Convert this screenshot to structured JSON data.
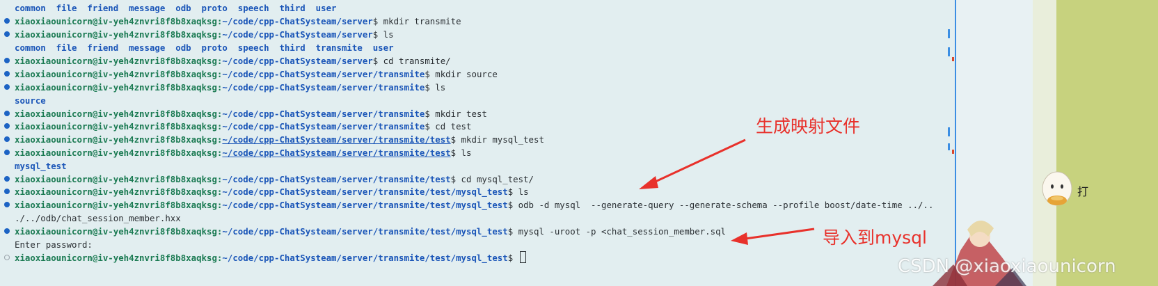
{
  "terminal": {
    "lines": [
      {
        "dot": "none",
        "prompt": "",
        "path": "",
        "cmd": "",
        "output": "common  file  friend  message  odb  proto  speech  third  user"
      },
      {
        "dot": "filled",
        "prompt": "xiaoxiaounicorn@iv-yeh4znvri8f8b8xaqksg:",
        "path": "~/code/cpp-ChatSysteam/server",
        "cmd": "$ mkdir transmite",
        "output": ""
      },
      {
        "dot": "filled",
        "prompt": "xiaoxiaounicorn@iv-yeh4znvri8f8b8xaqksg:",
        "path": "~/code/cpp-ChatSysteam/server",
        "cmd": "$ ls",
        "output": ""
      },
      {
        "dot": "none",
        "prompt": "",
        "path": "",
        "cmd": "",
        "output": "common  file  friend  message  odb  proto  speech  third  transmite  user"
      },
      {
        "dot": "filled",
        "prompt": "xiaoxiaounicorn@iv-yeh4znvri8f8b8xaqksg:",
        "path": "~/code/cpp-ChatSysteam/server",
        "cmd": "$ cd transmite/",
        "output": ""
      },
      {
        "dot": "filled",
        "prompt": "xiaoxiaounicorn@iv-yeh4znvri8f8b8xaqksg:",
        "path": "~/code/cpp-ChatSysteam/server/transmite",
        "cmd": "$ mkdir source",
        "output": ""
      },
      {
        "dot": "filled",
        "prompt": "xiaoxiaounicorn@iv-yeh4znvri8f8b8xaqksg:",
        "path": "~/code/cpp-ChatSysteam/server/transmite",
        "cmd": "$ ls",
        "output": ""
      },
      {
        "dot": "none",
        "prompt": "",
        "path": "",
        "cmd": "",
        "output": "source"
      },
      {
        "dot": "filled",
        "prompt": "xiaoxiaounicorn@iv-yeh4znvri8f8b8xaqksg:",
        "path": "~/code/cpp-ChatSysteam/server/transmite",
        "cmd": "$ mkdir test",
        "output": ""
      },
      {
        "dot": "filled",
        "prompt": "xiaoxiaounicorn@iv-yeh4znvri8f8b8xaqksg:",
        "path": "~/code/cpp-ChatSysteam/server/transmite",
        "cmd": "$ cd test",
        "output": ""
      },
      {
        "dot": "filled",
        "prompt": "xiaoxiaounicorn@iv-yeh4znvri8f8b8xaqksg:",
        "path": "~/code/cpp-ChatSysteam/server/transmite/test",
        "cmd": "$ mkdir mysql_test",
        "output": ""
      },
      {
        "dot": "filled",
        "prompt": "xiaoxiaounicorn@iv-yeh4znvri8f8b8xaqksg:",
        "path": "~/code/cpp-ChatSysteam/server/transmite/test",
        "cmd": "$ ls",
        "output": ""
      },
      {
        "dot": "none",
        "prompt": "",
        "path": "",
        "cmd": "",
        "output": "mysql_test"
      },
      {
        "dot": "filled",
        "prompt": "xiaoxiaounicorn@iv-yeh4znvri8f8b8xaqksg:",
        "path": "~/code/cpp-ChatSysteam/server/transmite/test",
        "cmd": "$ cd mysql_test/",
        "output": ""
      },
      {
        "dot": "filled",
        "prompt": "xiaoxiaounicorn@iv-yeh4znvri8f8b8xaqksg:",
        "path": "~/code/cpp-ChatSysteam/server/transmite/test/mysql_test",
        "cmd": "$ ls",
        "output": ""
      },
      {
        "dot": "filled",
        "prompt": "xiaoxiaounicorn@iv-yeh4znvri8f8b8xaqksg:",
        "path": "~/code/cpp-ChatSysteam/server/transmite/test/mysql_test",
        "cmd": "$ odb -d mysql  --generate-query --generate-schema --profile boost/date-time ../..",
        "output": ""
      },
      {
        "dot": "none",
        "prompt": "",
        "path": "",
        "cmd": "",
        "output": "./../odb/chat_session_member.hxx",
        "plain": true
      },
      {
        "dot": "filled",
        "prompt": "xiaoxiaounicorn@iv-yeh4znvri8f8b8xaqksg:",
        "path": "~/code/cpp-ChatSysteam/server/transmite/test/mysql_test",
        "cmd": "$ mysql -uroot -p <chat_session_member.sql",
        "output": ""
      },
      {
        "dot": "none",
        "prompt": "",
        "path": "",
        "cmd": "",
        "output": "Enter password:",
        "plain": true
      },
      {
        "dot": "hollow",
        "prompt": "xiaoxiaounicorn@iv-yeh4znvri8f8b8xaqksg:",
        "path": "~/code/cpp-ChatSysteam/server/transmite/test/mysql_test",
        "cmd": "$ ",
        "output": "",
        "cursor": true
      }
    ]
  },
  "annotations": {
    "generate_mapping": "生成映射文件",
    "import_mysql": "导入到mysql"
  },
  "watermark": "CSDN @xiaoxiaounicorn",
  "side_label": "打",
  "colors": {
    "background": "#e2eef0",
    "prompt": "#1a7a52",
    "path": "#1b56b8",
    "annotation": "#e8312b",
    "accent": "#3b8ee3"
  }
}
